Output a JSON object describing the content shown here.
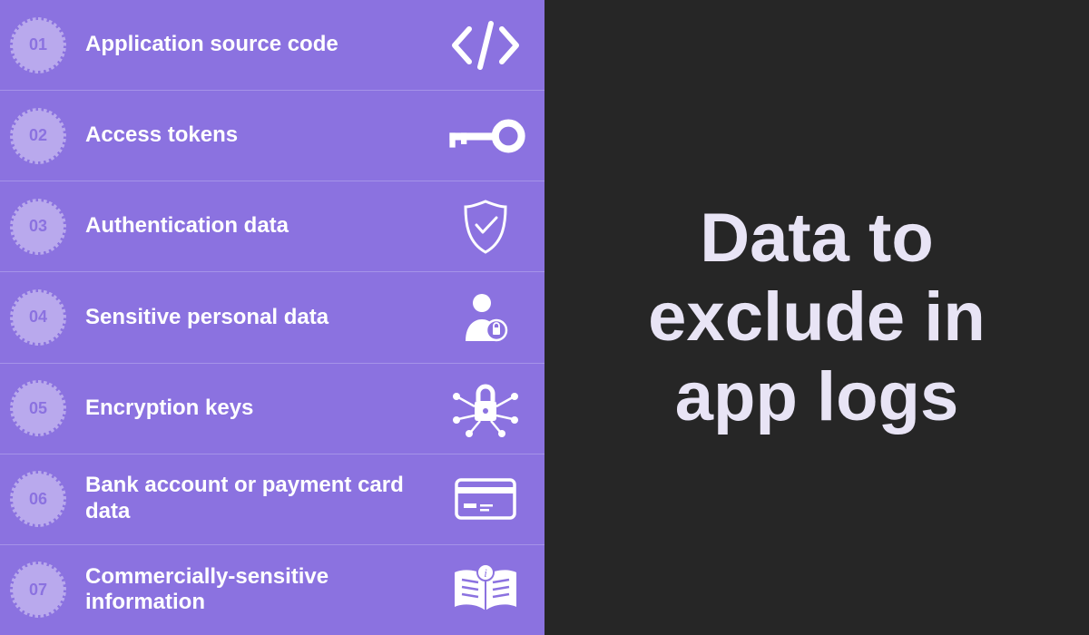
{
  "title": "Data to exclude in app logs",
  "items": [
    {
      "num": "01",
      "label": "Application source code",
      "icon": "code-icon"
    },
    {
      "num": "02",
      "label": "Access tokens",
      "icon": "key-icon"
    },
    {
      "num": "03",
      "label": "Authentication data",
      "icon": "shield-check-icon"
    },
    {
      "num": "04",
      "label": "Sensitive personal data",
      "icon": "person-lock-icon"
    },
    {
      "num": "05",
      "label": "Encryption keys",
      "icon": "lock-network-icon"
    },
    {
      "num": "06",
      "label": "Bank account or payment card data",
      "icon": "credit-card-icon"
    },
    {
      "num": "07",
      "label": "Commercially-sensitive information",
      "icon": "book-info-icon"
    }
  ],
  "colors": {
    "left_bg": "#8b72e0",
    "right_bg": "#262626",
    "badge_bg": "#b9a9ed",
    "text_light": "#e8e4f5",
    "text_white": "#ffffff"
  }
}
